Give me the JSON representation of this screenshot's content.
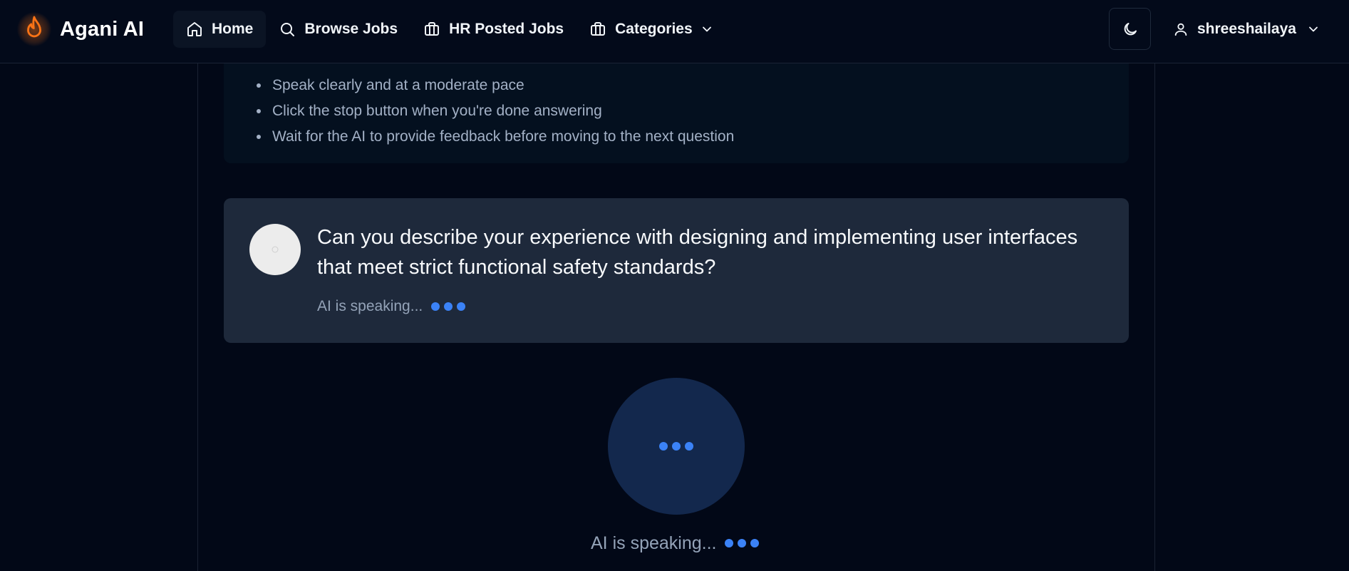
{
  "navbar": {
    "brand_name": "Agani AI",
    "links": [
      {
        "label": "Home",
        "icon": "home-icon",
        "active": true
      },
      {
        "label": "Browse Jobs",
        "icon": "search-icon"
      },
      {
        "label": "HR Posted Jobs",
        "icon": "briefcase-icon"
      },
      {
        "label": "Categories",
        "icon": "briefcase-icon",
        "has_dropdown": true
      }
    ],
    "theme_icon": "moon-icon",
    "user": {
      "name": "shreeshailaya",
      "icon": "user-icon"
    }
  },
  "tips": {
    "items": [
      "Speak clearly and at a moderate pace",
      "Click the stop button when you're done answering",
      "Wait for the AI to provide feedback before moving to the next question"
    ]
  },
  "question": {
    "text": "Can you describe your experience with designing and implementing user interfaces that meet strict functional safety standards?",
    "status": "AI is speaking..."
  },
  "speaker": {
    "status": "AI is speaking..."
  },
  "colors": {
    "background": "#020817",
    "card": "#1e293b",
    "accent": "#3b82f6",
    "brand": "#f97316"
  }
}
